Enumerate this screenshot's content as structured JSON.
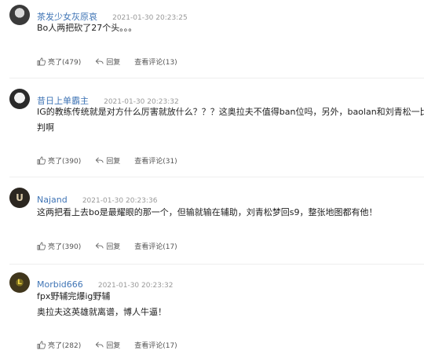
{
  "comments": [
    {
      "username": "茶发少女灰原哀",
      "time": "2021-01-30 20:23:25",
      "lines": [
        "Bo人两把砍了27个头。。。"
      ],
      "like_label": "亮了(479)",
      "reply_label": "回复",
      "view_label": "查看评论(13)"
    },
    {
      "username": "昔日上单霸主",
      "time": "2021-01-30 20:23:32",
      "lines": [
        "IG的教练传统就是对方什么厉害就放什么？？？这奥拉夫不值得ban位吗，另外，baolan和刘青松一比高",
        "判啊"
      ],
      "like_label": "亮了(390)",
      "reply_label": "回复",
      "view_label": "查看评论(31)"
    },
    {
      "username": "Najand",
      "time": "2021-01-30 20:23:36",
      "avatar_mark": "U",
      "lines": [
        "这两把看上去bo是最耀眼的那一个，但输就输在辅助，刘青松梦回s9，整张地图都有他！"
      ],
      "like_label": "亮了(390)",
      "reply_label": "回复",
      "view_label": "查看评论(17)"
    },
    {
      "username": "Morbid666",
      "time": "2021-01-30 20:23:32",
      "avatar_mark": "L",
      "lines": [
        "fpx野辅完爆ig野辅",
        "奥拉夫这英雄就离谱，博人牛逼！"
      ],
      "like_label": "亮了(282)",
      "reply_label": "回复",
      "view_label": "查看评论(17)"
    }
  ],
  "icons": {
    "like": "thumbs-up-icon",
    "reply": "reply-arrow-icon"
  }
}
